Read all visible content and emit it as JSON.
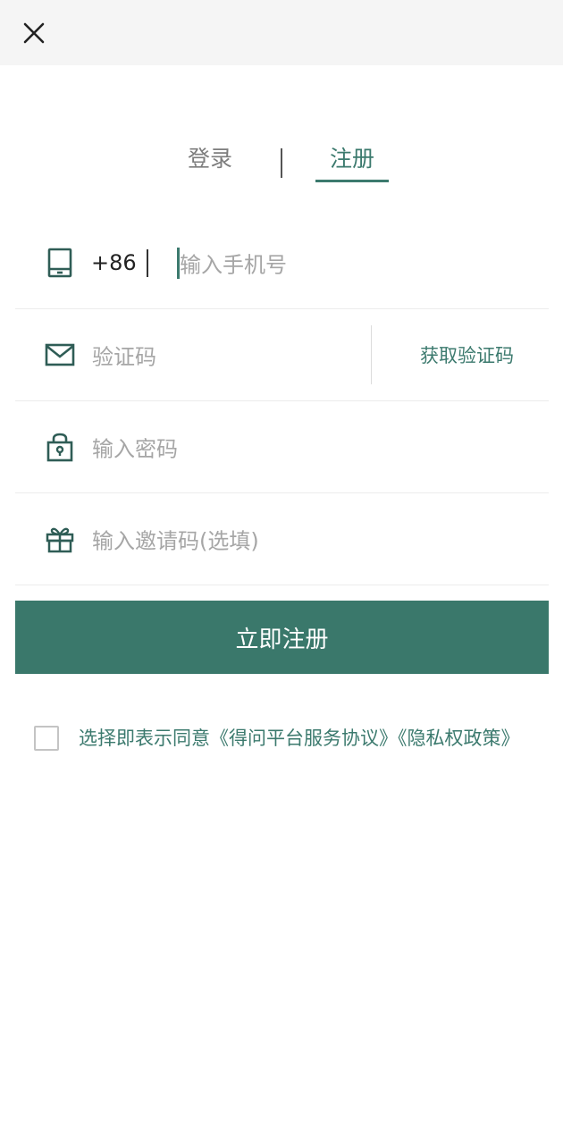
{
  "header": {
    "close_icon": "close-icon"
  },
  "tabs": [
    {
      "label": "登录",
      "active": false
    },
    {
      "label": "注册",
      "active": true
    }
  ],
  "form": {
    "phone": {
      "icon": "phone-icon",
      "country_code": "+86",
      "placeholder": "输入手机号",
      "value": ""
    },
    "verify_code": {
      "icon": "mail-icon",
      "placeholder": "验证码",
      "value": "",
      "get_code_label": "获取验证码"
    },
    "password": {
      "icon": "lock-icon",
      "placeholder": "输入密码",
      "value": ""
    },
    "invite_code": {
      "icon": "gift-icon",
      "placeholder": "输入邀请码(选填)",
      "value": ""
    }
  },
  "submit_label": "立即注册",
  "agreement": {
    "checked": false,
    "prefix": "选择即表示同意",
    "service_link": "《得问平台服务协议》",
    "privacy_link": "《隐私权政策》"
  },
  "colors": {
    "accent": "#3c7a6e",
    "button_bg": "#3a786b",
    "placeholder": "#a6a6a6",
    "topbar_bg": "#f5f5f5"
  }
}
